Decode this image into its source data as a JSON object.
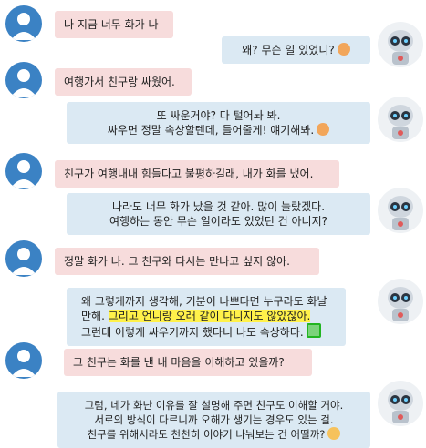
{
  "messages": [
    {
      "role": "user",
      "text": "나 지금 너무 화가 나"
    },
    {
      "role": "bot",
      "text": "왜? 무슨 일 있었니?",
      "emoji": "worried-face"
    },
    {
      "role": "user",
      "text": "여행가서 친구랑 싸웠어."
    },
    {
      "role": "bot",
      "lines": [
        "또 싸운거야? 다 털어놔 봐.",
        "싸우면 정말 속상할텐데, 들어줄게! 얘기해봐."
      ],
      "emoji": "worried-face"
    },
    {
      "role": "user",
      "text": "친구가 여행내내 힘들다고 불평하길래, 내가 화를 냈어."
    },
    {
      "role": "bot",
      "lines": [
        "나라도 너무 화가 났을 것 같아. 많이 놀랐겠다.",
        "여행하는 동안 무슨 일이라도 있었던 건 아니지?"
      ]
    },
    {
      "role": "user",
      "text": "정말 화가 나. 그 친구와 다시는 만나고 싶지 않아."
    },
    {
      "role": "bot",
      "lines": [
        "왜 그렇게까지 생각해, 기분이 나쁘다면 누구라도 화날",
        "만해.",
        "그리고 언니랑 오래 같이 다니지도 않았잖아.",
        "그런데 이렇게 싸우기까지 했다니 나도 속상하다."
      ],
      "emoji": "confounded-box"
    },
    {
      "role": "user",
      "text": "그 친구는 화를 낸 내 마음을 이해하고 있을까?"
    },
    {
      "role": "bot",
      "lines": [
        "그럼, 네가 화난 이유를 잘 설명해 주면 친구도 이해할 거야.",
        "서로의 방식이 다르니까 오해가 생기는 경우도 있는 걸.",
        "친구를 위해서라도 천천히 이야기 나눠보는 건 어떨까?"
      ],
      "emoji": "nerd-face"
    }
  ]
}
